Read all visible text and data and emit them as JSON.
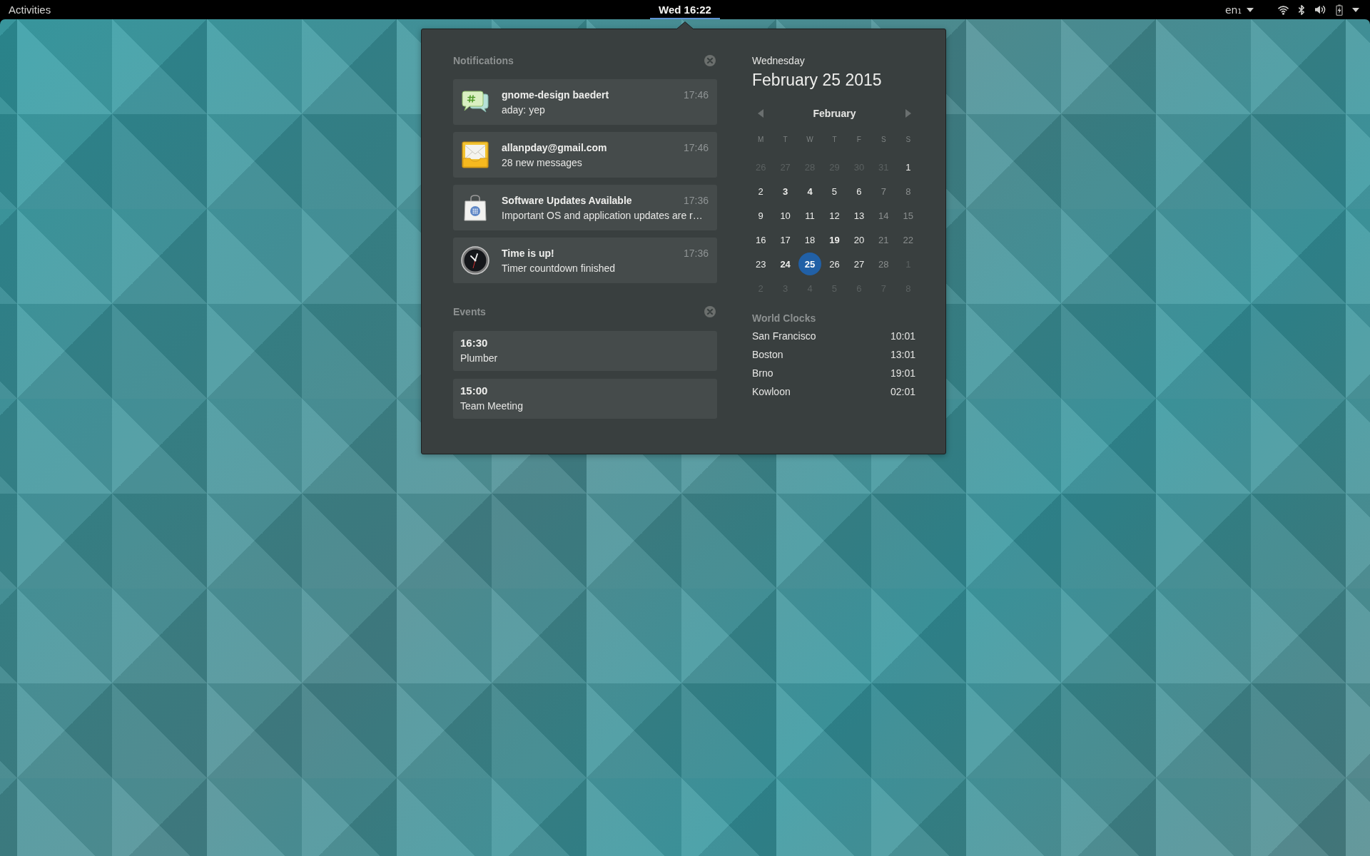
{
  "top_bar": {
    "activities": "Activities",
    "clock": {
      "label": "Wed 16:22",
      "selected": true
    },
    "keyboard": "en₁"
  },
  "notifications": {
    "title": "Notifications",
    "items": [
      {
        "kind": "chat",
        "title": "gnome-design baedert",
        "body": "aday: yep",
        "time": "17:46"
      },
      {
        "kind": "mail",
        "title": "allanpday@gmail.com",
        "body": "28 new messages",
        "time": "17:46"
      },
      {
        "kind": "software",
        "title": "Software Updates Available",
        "body": "Important OS and application updates are r…",
        "time": "17:36"
      },
      {
        "kind": "clock",
        "title": "Time is up!",
        "body": "Timer countdown finished",
        "time": "17:36"
      }
    ]
  },
  "events": {
    "title": "Events",
    "items": [
      {
        "time": "16:30",
        "title": "Plumber"
      },
      {
        "time": "15:00",
        "title": "Team Meeting"
      }
    ]
  },
  "date": {
    "weekday": "Wednesday",
    "full_date": "February 25 2015"
  },
  "calendar": {
    "month": "February",
    "weekdays": [
      "M",
      "T",
      "W",
      "T",
      "F",
      "S",
      "S"
    ],
    "days": [
      {
        "label": "26",
        "kind": "other_month",
        "has_events": false,
        "selected": false
      },
      {
        "label": "27",
        "kind": "other_month",
        "has_events": false,
        "selected": false
      },
      {
        "label": "28",
        "kind": "other_month",
        "has_events": false,
        "selected": false
      },
      {
        "label": "29",
        "kind": "other_month",
        "has_events": false,
        "selected": false
      },
      {
        "label": "30",
        "kind": "other_month",
        "has_events": false,
        "selected": false
      },
      {
        "label": "31",
        "kind": "other_month",
        "has_events": false,
        "selected": false
      },
      {
        "label": "1",
        "kind": "plain",
        "has_events": false,
        "selected": false
      },
      {
        "label": "2",
        "kind": "plain",
        "has_events": false,
        "selected": false
      },
      {
        "label": "3",
        "kind": "plain",
        "has_events": true,
        "selected": false
      },
      {
        "label": "4",
        "kind": "plain",
        "has_events": true,
        "selected": false
      },
      {
        "label": "5",
        "kind": "plain",
        "has_events": false,
        "selected": false
      },
      {
        "label": "6",
        "kind": "plain",
        "has_events": false,
        "selected": false
      },
      {
        "label": "7",
        "kind": "muted",
        "has_events": false,
        "selected": false
      },
      {
        "label": "8",
        "kind": "muted",
        "has_events": false,
        "selected": false
      },
      {
        "label": "9",
        "kind": "plain",
        "has_events": false,
        "selected": false
      },
      {
        "label": "10",
        "kind": "plain",
        "has_events": false,
        "selected": false
      },
      {
        "label": "11",
        "kind": "plain",
        "has_events": false,
        "selected": false
      },
      {
        "label": "12",
        "kind": "plain",
        "has_events": false,
        "selected": false
      },
      {
        "label": "13",
        "kind": "plain",
        "has_events": false,
        "selected": false
      },
      {
        "label": "14",
        "kind": "muted",
        "has_events": false,
        "selected": false
      },
      {
        "label": "15",
        "kind": "muted",
        "has_events": false,
        "selected": false
      },
      {
        "label": "16",
        "kind": "plain",
        "has_events": false,
        "selected": false
      },
      {
        "label": "17",
        "kind": "plain",
        "has_events": false,
        "selected": false
      },
      {
        "label": "18",
        "kind": "plain",
        "has_events": false,
        "selected": false
      },
      {
        "label": "19",
        "kind": "plain",
        "has_events": true,
        "selected": false
      },
      {
        "label": "20",
        "kind": "plain",
        "has_events": false,
        "selected": false
      },
      {
        "label": "21",
        "kind": "muted",
        "has_events": false,
        "selected": false
      },
      {
        "label": "22",
        "kind": "muted",
        "has_events": false,
        "selected": false
      },
      {
        "label": "23",
        "kind": "plain",
        "has_events": false,
        "selected": false
      },
      {
        "label": "24",
        "kind": "plain",
        "has_events": true,
        "selected": false
      },
      {
        "label": "25",
        "kind": "plain",
        "has_events": true,
        "selected": true
      },
      {
        "label": "26",
        "kind": "plain",
        "has_events": false,
        "selected": false
      },
      {
        "label": "27",
        "kind": "plain",
        "has_events": false,
        "selected": false
      },
      {
        "label": "28",
        "kind": "muted",
        "has_events": false,
        "selected": false
      },
      {
        "label": "1",
        "kind": "other_month",
        "has_events": false,
        "selected": false
      },
      {
        "label": "2",
        "kind": "other_month",
        "has_events": false,
        "selected": false
      },
      {
        "label": "3",
        "kind": "other_month",
        "has_events": false,
        "selected": false
      },
      {
        "label": "4",
        "kind": "other_month",
        "has_events": false,
        "selected": false
      },
      {
        "label": "5",
        "kind": "other_month",
        "has_events": false,
        "selected": false
      },
      {
        "label": "6",
        "kind": "other_month",
        "has_events": false,
        "selected": false
      },
      {
        "label": "7",
        "kind": "other_month",
        "has_events": false,
        "selected": false
      },
      {
        "label": "8",
        "kind": "other_month",
        "has_events": false,
        "selected": false
      }
    ]
  },
  "world_clocks": {
    "title": "World Clocks",
    "items": [
      {
        "city": "San Francisco",
        "time": "10:01"
      },
      {
        "city": "Boston",
        "time": "13:01"
      },
      {
        "city": "Brno",
        "time": "19:01"
      },
      {
        "city": "Kowloon",
        "time": "02:01"
      }
    ]
  }
}
